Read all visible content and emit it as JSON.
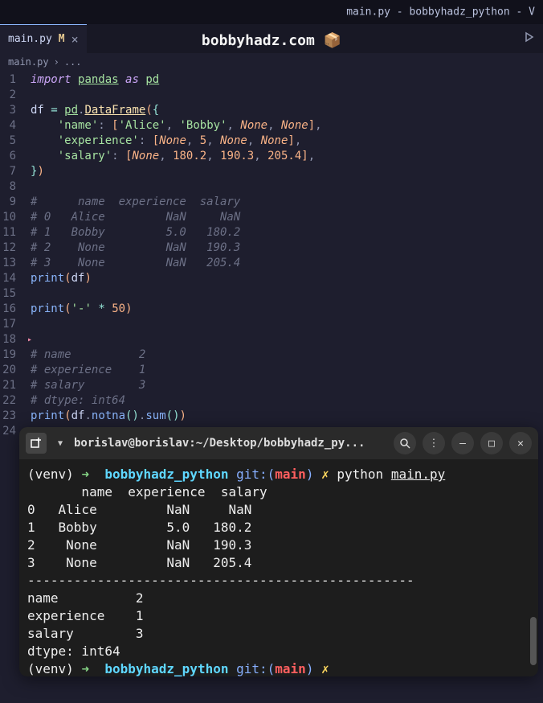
{
  "title_bar": "main.py - bobbyhadz_python - V",
  "watermark": "bobbyhadz.com 📦",
  "tab": {
    "name": "main.py",
    "modified": "M"
  },
  "breadcrumb": {
    "file": "main.py",
    "sep": "›",
    "more": "..."
  },
  "lines": [
    "1",
    "2",
    "3",
    "4",
    "5",
    "6",
    "7",
    "8",
    "9",
    "10",
    "11",
    "12",
    "13",
    "14",
    "15",
    "16",
    "17",
    "18",
    "19",
    "20",
    "21",
    "22",
    "23",
    "24"
  ],
  "code": {
    "import": "import",
    "pandas": "pandas",
    "as": "as",
    "pd": "pd",
    "df": "df",
    "eq": "=",
    "DataFrame": "DataFrame",
    "name_key": "'name'",
    "exp_key": "'experience'",
    "sal_key": "'salary'",
    "alice": "'Alice'",
    "bobby": "'Bobby'",
    "none": "None",
    "n5": "5",
    "n180": "180.2",
    "n190": "190.3",
    "n205": "205.4",
    "n50": "50",
    "c1": "#      name  experience  salary",
    "c2": "# 0   Alice         NaN     NaN",
    "c3": "# 1   Bobby         5.0   180.2",
    "c4": "# 2    None         NaN   190.3",
    "c5": "# 3    None         NaN   205.4",
    "print": "print",
    "dash": "'-'",
    "star": "*",
    "c6": "# name          2",
    "c7": "# experience    1",
    "c8": "# salary        3",
    "c9": "# dtype: int64",
    "notna": "notna",
    "sum": "sum"
  },
  "terminal": {
    "title": "borislav@borislav:~/Desktop/bobbyhadz_py...",
    "venv": "(venv)",
    "arrow": "➜",
    "dir": "bobbyhadz_python",
    "git": "git:",
    "branch": "main",
    "x": "✗",
    "cmd_python": "python",
    "cmd_file": "main.py",
    "out1": "       name  experience  salary",
    "out2": "0   Alice         NaN     NaN",
    "out3": "1   Bobby         5.0   180.2",
    "out4": "2    None         NaN   190.3",
    "out5": "3    None         NaN   205.4",
    "sep": "--------------------------------------------------",
    "out6": "name          2",
    "out7": "experience    1",
    "out8": "salary        3",
    "out9": "dtype: int64"
  }
}
